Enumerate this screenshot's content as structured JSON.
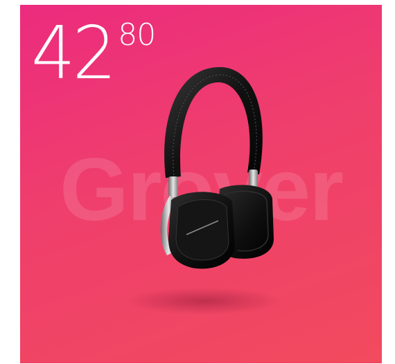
{
  "price": {
    "main": "42",
    "cents": "80"
  },
  "watermark": {
    "text": "Grover"
  },
  "product": {
    "icon": "headphones-icon"
  },
  "colors": {
    "background_top": "#ec2b7e",
    "background_bottom": "#f24a5e",
    "price_text": "#ffffff"
  }
}
